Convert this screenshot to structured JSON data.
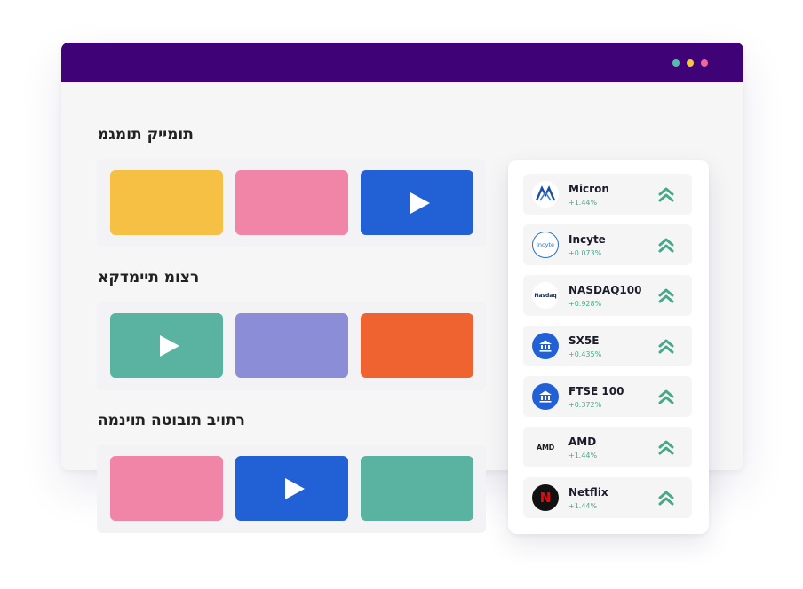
{
  "window": {
    "titlebar_color": "#3f0377",
    "dots": [
      {
        "name": "green-dot",
        "color": "#4cc3a6"
      },
      {
        "name": "yellow-dot",
        "color": "#f4c648"
      },
      {
        "name": "pink-dot",
        "color": "#f0669a"
      }
    ]
  },
  "sections": [
    {
      "title": "תומייק תומגמ",
      "cards": [
        {
          "color": "#f5c044",
          "play": false
        },
        {
          "color": "#f085a8",
          "play": false
        },
        {
          "color": "#2260d6",
          "play": true
        }
      ]
    },
    {
      "title": "רצומ תיימדקא",
      "cards": [
        {
          "color": "#5ab2a0",
          "play": true
        },
        {
          "color": "#8b8ed6",
          "play": false
        },
        {
          "color": "#ee6330",
          "play": false
        }
      ]
    },
    {
      "title": "רתויב תובוטה תוינמה",
      "cards": [
        {
          "color": "#f085a8",
          "play": false
        },
        {
          "color": "#2260d6",
          "play": true
        },
        {
          "color": "#5ab2a0",
          "play": false
        }
      ]
    }
  ],
  "stocks": [
    {
      "name": "Micron",
      "change": "+1.44%",
      "logo": "micron-logo",
      "logo_text": "M"
    },
    {
      "name": "Incyte",
      "change": "+0.073%",
      "logo": "incyte-logo",
      "logo_text": "Incyte"
    },
    {
      "name": "NASDAQ100",
      "change": "+0.928%",
      "logo": "nasdaq-logo",
      "logo_text": "Nasdaq"
    },
    {
      "name": "SX5E",
      "change": "+0.435%",
      "logo": "bank-icon",
      "logo_text": ""
    },
    {
      "name": "FTSE 100",
      "change": "+0.372%",
      "logo": "bank-icon",
      "logo_text": ""
    },
    {
      "name": "AMD",
      "change": "+1.44%",
      "logo": "amd-logo",
      "logo_text": "AMD"
    },
    {
      "name": "Netflix",
      "change": "+1.44%",
      "logo": "netflix-logo",
      "logo_text": "N"
    }
  ],
  "colors": {
    "up_trend": "#49a88a",
    "bank_blue": "#2260d6",
    "netflix_red": "#e50914"
  }
}
